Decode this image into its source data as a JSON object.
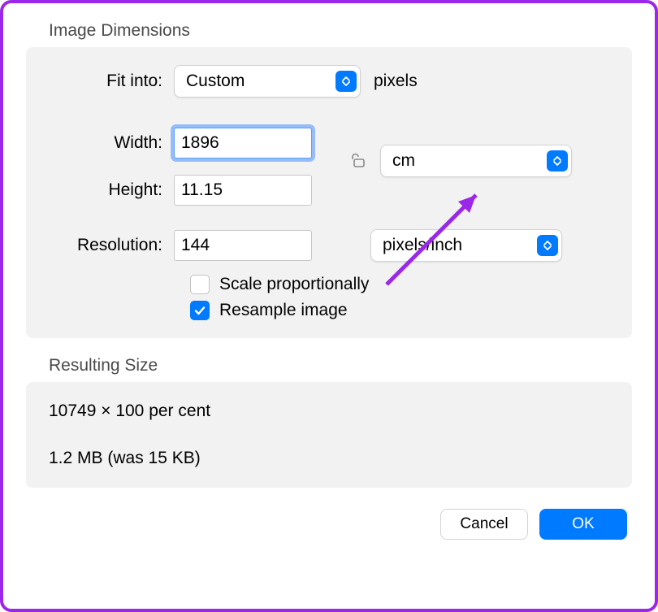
{
  "dimensions": {
    "title": "Image Dimensions",
    "fit_into_label": "Fit into:",
    "fit_into_value": "Custom",
    "fit_into_unit": "pixels",
    "width_label": "Width:",
    "width_value": "1896",
    "height_label": "Height:",
    "height_value": "11.15",
    "unit_select": "cm",
    "resolution_label": "Resolution:",
    "resolution_value": "144",
    "resolution_unit": "pixels/inch",
    "scale_label": "Scale proportionally",
    "scale_checked": false,
    "resample_label": "Resample image",
    "resample_checked": true
  },
  "resulting": {
    "title": "Resulting Size",
    "percent_line": "10749 × 100 per cent",
    "size_line": "1.2 MB (was 15 KB)"
  },
  "buttons": {
    "cancel": "Cancel",
    "ok": "OK"
  }
}
